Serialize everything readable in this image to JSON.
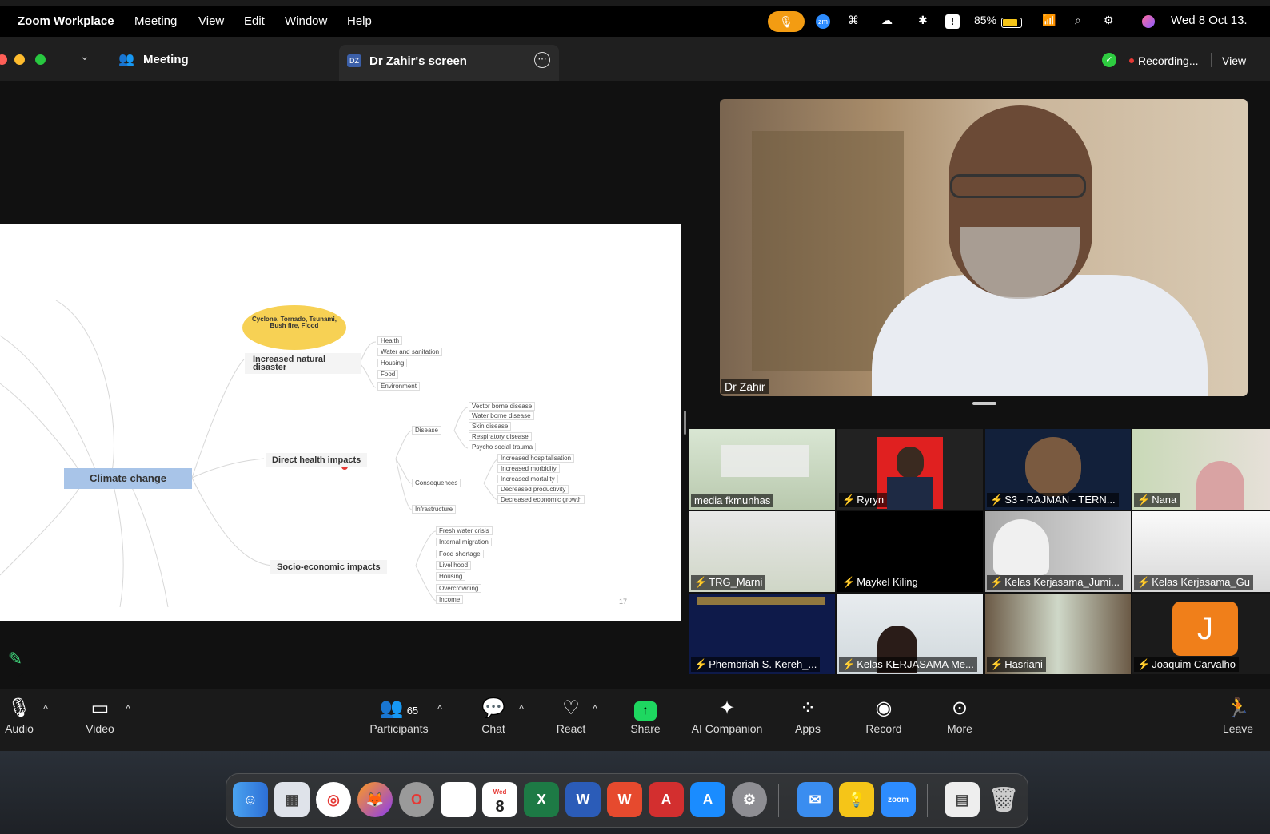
{
  "menubar": {
    "app_name": "Zoom Workplace",
    "menus": [
      "Meeting",
      "View",
      "Edit",
      "Window",
      "Help"
    ],
    "battery": "85%",
    "datetime": "Wed 8 Oct 13."
  },
  "titlebar": {
    "meeting_label": "Meeting",
    "screen_badge": "DZ",
    "screen_title": "Dr Zahir's screen",
    "recording": "Recording...",
    "view": "View"
  },
  "slide": {
    "root": "Climate change",
    "bubble": "Cyclone, Tornado, Tsunami, Bush fire, Flood",
    "branch1": "Increased natural disaster",
    "branch1_items": [
      "Health",
      "Water and sanitation",
      "Housing",
      "Food",
      "Environment"
    ],
    "branch2": "Direct health impacts",
    "disease": "Disease",
    "disease_items": [
      "Vector borne disease",
      "Water borne disease",
      "Skin disease",
      "Respiratory disease",
      "Psycho social trauma"
    ],
    "consequences": "Consequences",
    "consequences_items": [
      "Increased hospitalisation",
      "Increased morbidity",
      "Increased mortality",
      "Decreased productivity",
      "Decreased economic growth"
    ],
    "infrastructure": "Infrastructure",
    "branch3": "Socio-economic impacts",
    "branch3_items": [
      "Fresh water crisis",
      "Internal migration",
      "Food shortage",
      "Livelihood",
      "Housing",
      "Overcrowding",
      "Income"
    ],
    "page_number": "17"
  },
  "speaker": {
    "name": "Dr Zahir"
  },
  "participants": [
    {
      "name": "media fkmunhas",
      "muted": false
    },
    {
      "name": "Ryryn",
      "muted": true
    },
    {
      "name": "S3 - RAJMAN - TERN...",
      "muted": true
    },
    {
      "name": "Nana",
      "muted": true
    },
    {
      "name": "TRG_Marni",
      "muted": true
    },
    {
      "name": "Maykel Kiling",
      "muted": true
    },
    {
      "name": "Kelas Kerjasama_Jumi...",
      "muted": true
    },
    {
      "name": "Kelas Kerjasama_Gu",
      "muted": true
    },
    {
      "name": "Phembriah S. Kereh_...",
      "muted": true
    },
    {
      "name": "Kelas KERJASAMA Me...",
      "muted": true
    },
    {
      "name": "Hasriani",
      "muted": true
    },
    {
      "name": "Joaquim Carvalho",
      "muted": true
    }
  ],
  "tile_avatar_letter": "J",
  "toolbar": {
    "audio": "Audio",
    "video": "Video",
    "participants": "Participants",
    "participants_count": "65",
    "chat": "Chat",
    "react": "React",
    "share": "Share",
    "ai_companion": "AI Companion",
    "apps": "Apps",
    "record": "Record",
    "more": "More",
    "leave": "Leave"
  },
  "dock": {
    "calendar_day": "Wed",
    "calendar_date": "8",
    "zoom_label": "zoom"
  },
  "colors": {
    "recording_dot": "#e53935",
    "shield": "#2ecc40",
    "share_green": "#1ed760",
    "root_node": "#a8c4e8",
    "bubble": "#f7d154"
  }
}
